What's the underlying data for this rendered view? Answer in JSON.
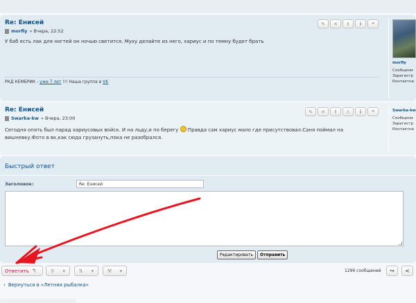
{
  "posts": [
    {
      "title": "Re: Енисей",
      "author": "morfiy",
      "time": "» Вчера, 22:52",
      "text": "У баб есть лак для ногтей он ночью светится. Муху делайте из него, хариус и по темну будет брать",
      "signature": {
        "prefix": "РКД КЕМБРИК - ",
        "link1": "уже 7 лет",
        "middle": " !!! Наша группа в ",
        "link2": "VK"
      },
      "actions": [
        "✎",
        "✕",
        "!",
        "i",
        "❝"
      ],
      "profile": {
        "name": "morfiy",
        "info": [
          "Сообщени",
          "Зарегистр",
          "Контактна"
        ]
      }
    },
    {
      "title": "Re: Енисей",
      "author": "Swarka-kw",
      "time": "» Вчера, 23:00",
      "text_before": "Сегодня опять был парад хариусовых войск. И на льду,и по берегу",
      "text_after": " Правда сам хариус мало где присутствовал.Саня поймал на вишневку.Фото в вк,как сюда грузануть,пока не разобрался.",
      "actions": [
        "✎",
        "✕",
        "!",
        "⚠",
        "i",
        "❝"
      ],
      "profile": {
        "name": "Swarka-kw",
        "info": [
          "Сообщени",
          "Зарегистр",
          "Контактна"
        ]
      }
    }
  ],
  "quick_reply": {
    "title": "Быстрый ответ",
    "subject_label": "Заголовок:",
    "subject_value": "Re: Енисей",
    "edit_button": "Редактировать",
    "send_button": "Отправить"
  },
  "action_bar": {
    "reply_label": "Ответить",
    "reply_icon": "reply-arrow-icon",
    "tools": [
      {
        "icon": "wrench-icon",
        "glyph": "🔧"
      },
      {
        "icon": "sort-icon",
        "glyph": "↕"
      },
      {
        "icon": "hammer-icon",
        "glyph": "⚒"
      }
    ],
    "message_count": "1296 сообщений",
    "next_glyph": "↪",
    "prev_glyph": "<"
  },
  "back_link": "Вернуться в «Летняя рыбалка»",
  "colors": {
    "post_bg_1": "#e1ebf2",
    "post_bg_2": "#ecf3f7",
    "title": "#105289",
    "reply_text": "#d31141",
    "arrow": "#e8141f"
  }
}
